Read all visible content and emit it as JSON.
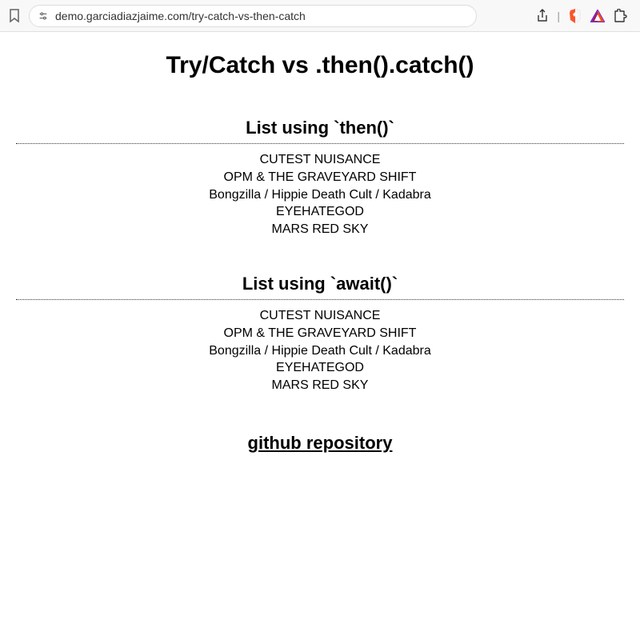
{
  "toolbar": {
    "url": "demo.garciadiazjaime.com/try-catch-vs-then-catch"
  },
  "content": {
    "title": "Try/Catch vs .then().catch()",
    "sections": [
      {
        "heading": "List using `then()`",
        "items": [
          "CUTEST NUISANCE",
          "OPM & THE GRAVEYARD SHIFT",
          "Bongzilla / Hippie Death Cult / Kadabra",
          "EYEHATEGOD",
          "MARS RED SKY"
        ]
      },
      {
        "heading": "List using `await()`",
        "items": [
          "CUTEST NUISANCE",
          "OPM & THE GRAVEYARD SHIFT",
          "Bongzilla / Hippie Death Cult / Kadabra",
          "EYEHATEGOD",
          "MARS RED SKY"
        ]
      }
    ],
    "link_text": "github repository"
  }
}
